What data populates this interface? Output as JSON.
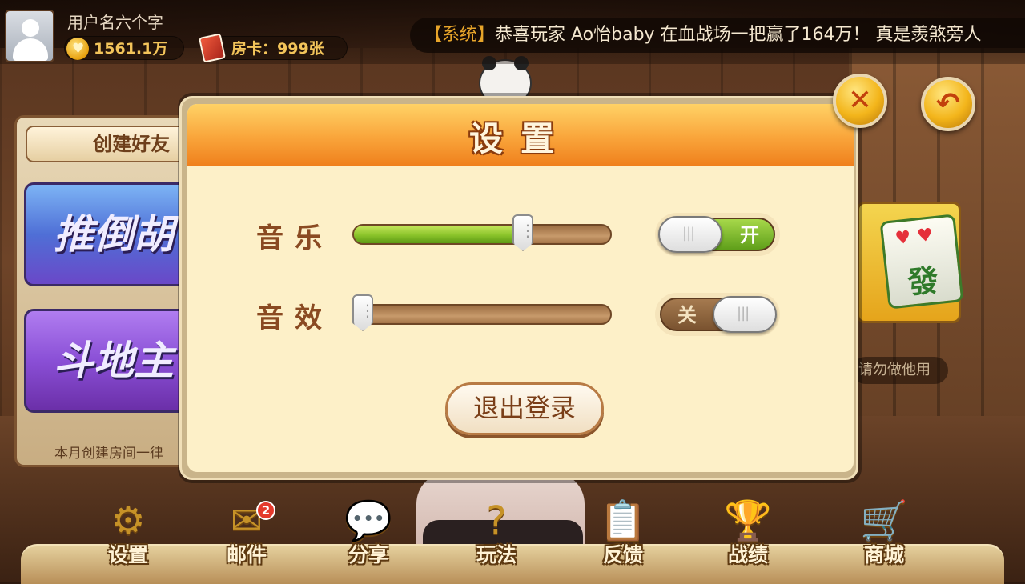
{
  "player": {
    "username": "用户名六个字",
    "gold": "1561.1万",
    "room_cards": "房卡：999张"
  },
  "ticker": {
    "tag": "【系统】",
    "message": "恭喜玩家 Ao怡baby 在血战场一把赢了164万！ 真是羡煞旁人"
  },
  "background": {
    "create_room_tab": "创建好友",
    "game_cards": [
      "推倒胡",
      "斗地主"
    ],
    "left_note": "本月创建房间一律",
    "right_note": "请勿做他用",
    "mahjong_tile_char": "發"
  },
  "settings_dialog": {
    "title": "设置",
    "music": {
      "label": "音乐",
      "volume_fraction": 0.67,
      "switch_state": "on",
      "switch_text": "开"
    },
    "sound_effects": {
      "label": "音效",
      "volume_fraction": 0.0,
      "switch_state": "off",
      "switch_text": "关"
    },
    "logout_label": "退出登录"
  },
  "bottom_nav": [
    {
      "label": "设置",
      "icon": "gear-icon",
      "glyph": "⚙"
    },
    {
      "label": "邮件",
      "icon": "mail-icon",
      "glyph": "✉",
      "badge": "2"
    },
    {
      "label": "分享",
      "icon": "chat-bubble-icon",
      "glyph": "💬"
    },
    {
      "label": "玩法",
      "icon": "question-icon",
      "glyph": "?"
    },
    {
      "label": "反馈",
      "icon": "clipboard-icon",
      "glyph": "📋"
    },
    {
      "label": "战绩",
      "icon": "trophy-icon",
      "glyph": "🏆"
    },
    {
      "label": "商城",
      "icon": "shopping-cart-icon",
      "glyph": "🛒"
    }
  ],
  "colors": {
    "accent_orange": "#f9a43a",
    "switch_on_green": "#8ac32a",
    "switch_off_brown": "#7a5330",
    "text_brown": "#8a4a22"
  }
}
